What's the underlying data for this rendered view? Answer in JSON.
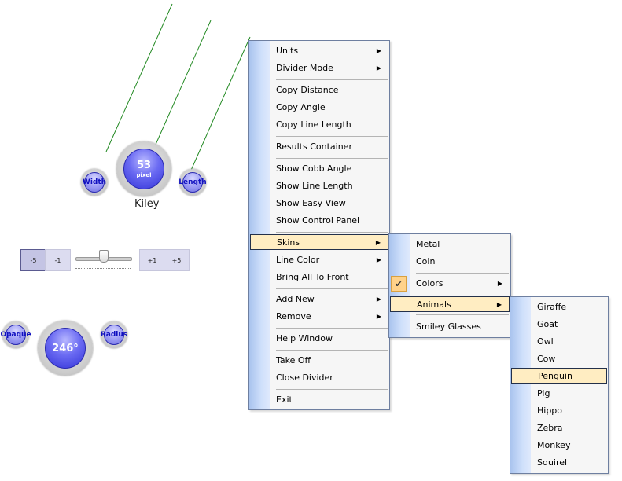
{
  "measure": {
    "value": "53",
    "unit": "pixel",
    "person": "Kiley",
    "left_button": "Width",
    "right_button": "Length"
  },
  "steppers": [
    "-5",
    "-1",
    "+1",
    "+5"
  ],
  "angle": {
    "value": "246°",
    "left_button": "Opaque",
    "right_button": "Radius"
  },
  "colors": {
    "guide_line": "#238a23",
    "menu_highlight": "#ffedc2",
    "menu_gutter": "#a9c3ee"
  },
  "main_menu": {
    "items": [
      {
        "label": "Units",
        "submenu": true
      },
      {
        "label": "Divider Mode",
        "submenu": true
      },
      {
        "label": "Copy Distance"
      },
      {
        "label": "Copy Angle"
      },
      {
        "label": "Copy Line Length"
      },
      {
        "label": "Results Container"
      },
      {
        "label": "Show Cobb Angle"
      },
      {
        "label": "Show Line Length"
      },
      {
        "label": "Show Easy View"
      },
      {
        "label": "Show Control Panel"
      },
      {
        "label": "Skins",
        "submenu": true,
        "highlighted": true
      },
      {
        "label": "Line Color",
        "submenu": true
      },
      {
        "label": "Bring All To Front"
      },
      {
        "label": "Add New",
        "submenu": true
      },
      {
        "label": "Remove",
        "submenu": true
      },
      {
        "label": "Help Window"
      },
      {
        "label": "Take Off"
      },
      {
        "label": "Close Divider"
      },
      {
        "label": "Exit"
      }
    ]
  },
  "skins_menu": {
    "items": [
      {
        "label": "Metal"
      },
      {
        "label": "Coin"
      },
      {
        "label": "Colors",
        "submenu": true,
        "checked": true
      },
      {
        "label": "Animals",
        "submenu": true,
        "highlighted": true
      },
      {
        "label": "Smiley Glasses"
      }
    ]
  },
  "animals_menu": {
    "items": [
      {
        "label": "Giraffe"
      },
      {
        "label": "Goat"
      },
      {
        "label": "Owl"
      },
      {
        "label": "Cow"
      },
      {
        "label": "Penguin",
        "highlighted": true
      },
      {
        "label": "Pig"
      },
      {
        "label": "Hippo"
      },
      {
        "label": "Zebra"
      },
      {
        "label": "Monkey"
      },
      {
        "label": "Squirel"
      }
    ]
  }
}
